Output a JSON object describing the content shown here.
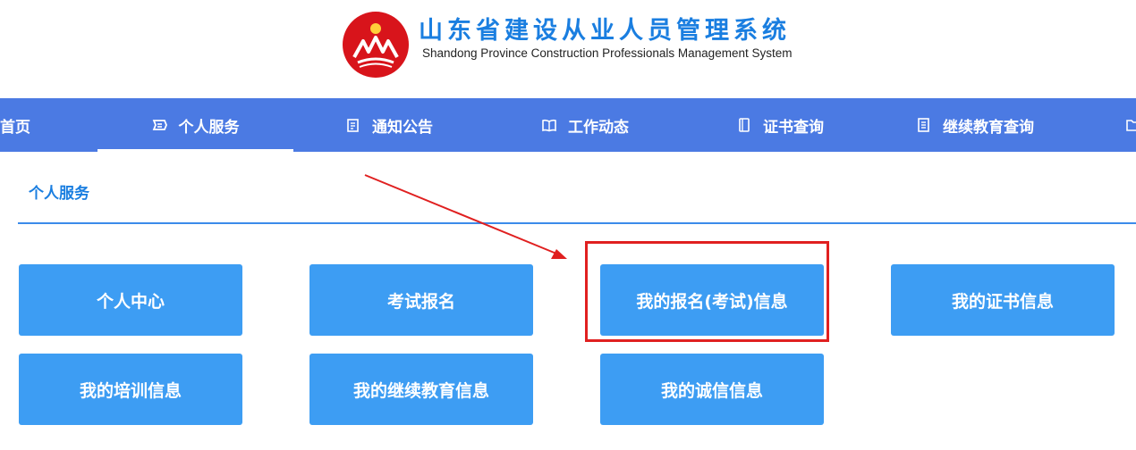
{
  "header": {
    "title_cn": "山东省建设从业人员管理系统",
    "title_en": "Shandong Province Construction Professionals Management System"
  },
  "nav": {
    "items": [
      {
        "label": "首页",
        "icon": "home-icon"
      },
      {
        "label": "个人服务",
        "icon": "id-card-icon",
        "active": true
      },
      {
        "label": "通知公告",
        "icon": "notice-icon"
      },
      {
        "label": "工作动态",
        "icon": "book-open-icon"
      },
      {
        "label": "证书查询",
        "icon": "certificate-icon"
      },
      {
        "label": "继续教育查询",
        "icon": "document-list-icon"
      }
    ]
  },
  "section": {
    "title": "个人服务"
  },
  "tiles": [
    {
      "label": "个人中心"
    },
    {
      "label": "考试报名"
    },
    {
      "label": "我的报名(考试)信息",
      "highlighted": true
    },
    {
      "label": "我的证书信息"
    },
    {
      "label": "我的培训信息"
    },
    {
      "label": "我的继续教育信息"
    },
    {
      "label": "我的诚信信息"
    }
  ],
  "colors": {
    "nav_bg": "#4b7ae3",
    "tile_bg": "#3d9df3",
    "title_blue": "#1a7ee0",
    "annotation_red": "#e02020",
    "logo_red": "#d8141b"
  }
}
